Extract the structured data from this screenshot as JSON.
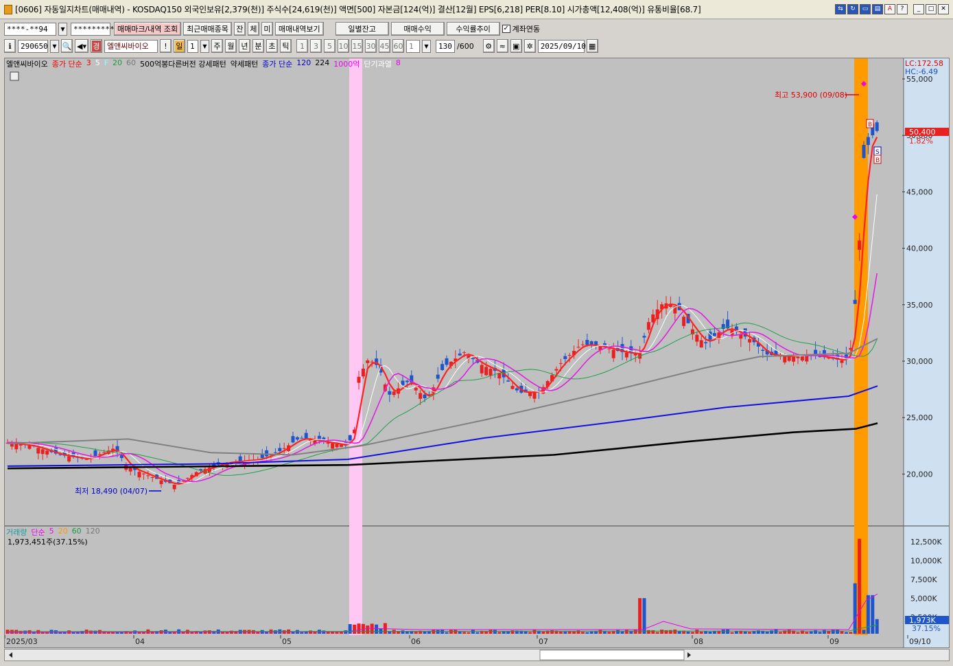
{
  "window": {
    "title": "[0606] 자동일지차트(매매내역) - KOSDAQ150 외국인보유[2,379(천)] 주식수[24,619(천)] 액면[500] 자본금[124(억)] 결산[12월] EPS[6,218] PER[8.10] 시가총액[12,408(억)] 유통비율[68.7]"
  },
  "toolbar1": {
    "account": "****-**94",
    "password": "*********",
    "btn_mark": "매매마크/내역 조회",
    "btn_recent": "최근매매종목",
    "btn_jan": "잔",
    "btn_che": "체",
    "btn_mi": "미",
    "btn_history": "매매내역보기",
    "btn_daily": "일별잔고",
    "btn_profit": "매매수익",
    "btn_return": "수익률추이",
    "chk_label": "계좌연동",
    "chk_mark": "✓"
  },
  "toolbar2": {
    "code": "290650",
    "gyeong": "경",
    "stock_name": "엘앤씨바이오",
    "excl": "!",
    "period": "일",
    "period_n": "1",
    "tabs": [
      "주",
      "월",
      "년",
      "분",
      "초",
      "틱"
    ],
    "nums": [
      "1",
      "3",
      "5",
      "10",
      "15",
      "30",
      "45",
      "60"
    ],
    "n_val": "1",
    "count": "130",
    "count_total": "/600",
    "date": "2025/09/10"
  },
  "legend": {
    "stock": "엘앤씨바이오",
    "ma_label": "종가 단순",
    "ma3": "3",
    "ma5": "5",
    "ma_f": "F",
    "ma20": "20",
    "ma60": "60",
    "pattern": "500억봉다른버전 강세패턴",
    "weak": "약세패턴",
    "ma2_label": "종가 단순",
    "ma120": "120",
    "ma224": "224",
    "p1000": "1000억",
    "short": "단기과열",
    "short_n": "8"
  },
  "price_axis": {
    "labels": [
      "55,000",
      "50,000",
      "45,000",
      "40,000",
      "35,000",
      "30,000",
      "25,000",
      "20,000"
    ],
    "lc": "LC:172.58",
    "hc": "HC:-6.49",
    "current": "50,400",
    "pct": "1.82%"
  },
  "annot": {
    "high": "최고 53,900 (09/08)",
    "low": "최저 18,490 (04/07)",
    "buy": "B",
    "sell": "S"
  },
  "volume": {
    "legend": {
      "label": "거래량",
      "ma_label": "단순",
      "ma5": "5",
      "ma20": "20",
      "ma60": "60",
      "ma120": "120"
    },
    "summary": "1,973,451주(37.15%)",
    "axis": [
      "12,500K",
      "10,000K",
      "7,500K",
      "5,000K",
      "2,500K"
    ],
    "current": "1,973K",
    "pct": "37.15%"
  },
  "date_axis": [
    "2025/03",
    "04",
    "05",
    "06",
    "07",
    "08",
    "09",
    "09/10"
  ],
  "colors": {
    "up": "#e82020",
    "down": "#1f55cc",
    "ma3": "#ff2020",
    "ma5": "#ffffff",
    "ma20": "#1e9e48",
    "ma60": "#808080",
    "ma120": "#1010e0",
    "ma224": "#000000",
    "pink": "#e020e0",
    "orange": "#ff9a00",
    "hl_pink": "#ffc8f4"
  }
}
